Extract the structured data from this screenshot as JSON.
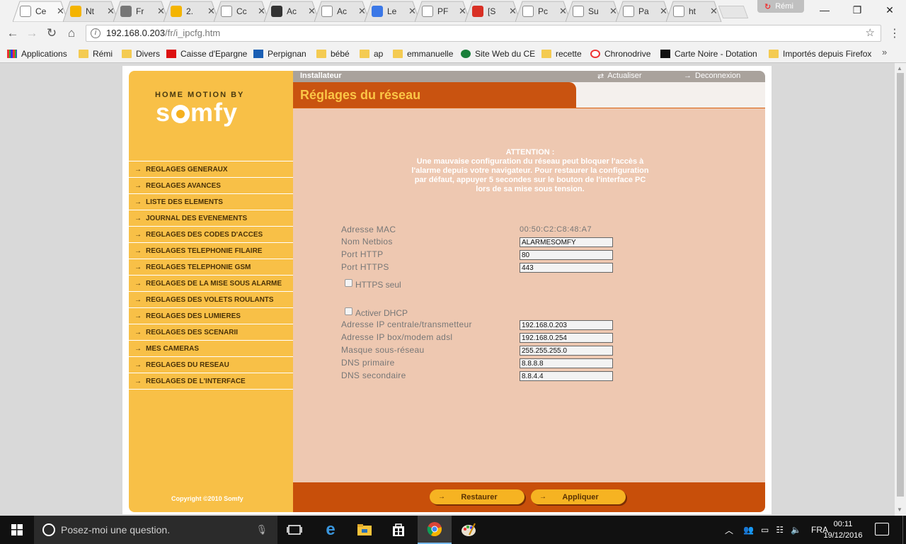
{
  "browser": {
    "tabs": [
      {
        "title": "Ce",
        "icon": "document-icon",
        "color": "#ffffff"
      },
      {
        "title": "Nt",
        "icon": "orange-circle-icon",
        "color": "#f4b400"
      },
      {
        "title": "Fr",
        "icon": "cloud-icon",
        "color": "#777777"
      },
      {
        "title": "2.",
        "icon": "clock-icon",
        "color": "#f4b400"
      },
      {
        "title": "Cc",
        "icon": "document-icon",
        "color": "#ffffff"
      },
      {
        "title": "Ac",
        "icon": "letter-a-icon",
        "color": "#333333"
      },
      {
        "title": "Ac",
        "icon": "document-icon",
        "color": "#ffffff"
      },
      {
        "title": "Le",
        "icon": "letter-e-icon",
        "color": "#3b78e7"
      },
      {
        "title": "PF",
        "icon": "document-icon",
        "color": "#ffffff"
      },
      {
        "title": "[S",
        "icon": "gmail-icon",
        "color": "#d93025"
      },
      {
        "title": "Pc",
        "icon": "document-icon",
        "color": "#ffffff"
      },
      {
        "title": "Su",
        "icon": "document-icon",
        "color": "#ffffff"
      },
      {
        "title": "Pa",
        "icon": "document-icon",
        "color": "#ffffff"
      },
      {
        "title": "ht",
        "icon": "document-icon",
        "color": "#ffffff"
      }
    ],
    "profile_name": "Rémi",
    "url_host": "192.168.0.203",
    "url_path": "/fr/i_ipcfg.htm",
    "bookmarks": [
      {
        "label": "Applications",
        "icon": "apps-grid-icon"
      },
      {
        "label": "Rémi",
        "icon": "folder-icon"
      },
      {
        "label": "Divers",
        "icon": "folder-icon"
      },
      {
        "label": "Caisse d'Epargne",
        "icon": "caisse-epargne-icon"
      },
      {
        "label": "Perpignan",
        "icon": "perpignan-icon"
      },
      {
        "label": "bébé",
        "icon": "folder-icon"
      },
      {
        "label": "ap",
        "icon": "folder-icon"
      },
      {
        "label": "emmanuelle",
        "icon": "folder-icon"
      },
      {
        "label": "Site Web du CE",
        "icon": "globe-icon"
      },
      {
        "label": "recette",
        "icon": "folder-icon"
      },
      {
        "label": "Chronodrive",
        "icon": "chronodrive-icon"
      },
      {
        "label": "Carte Noire - Dotation",
        "icon": "carte-noire-icon"
      },
      {
        "label": "Importés depuis Firefox",
        "icon": "folder-icon"
      }
    ],
    "bookmarks_more": "»"
  },
  "app": {
    "brand_top": "HOME MOTION BY",
    "brand": "somfy",
    "menu": [
      "REGLAGES GENERAUX",
      "REGLAGES AVANCES",
      "LISTE DES ELEMENTS",
      "JOURNAL DES EVENEMENTS",
      "REGLAGES DES CODES D'ACCES",
      "REGLAGES TELEPHONIE FILAIRE",
      "REGLAGES TELEPHONIE GSM",
      "REGLAGES DE LA MISE SOUS ALARME",
      "REGLAGES DES VOLETS ROULANTS",
      "REGLAGES DES LUMIERES",
      "REGLAGES DES SCENARII",
      "MES CAMERAS",
      "REGLAGES DU RESEAU",
      "REGLAGES DE L'INTERFACE"
    ],
    "copyright": "Copyright ©2010 Somfy",
    "role": "Installateur",
    "refresh_label": "Actualiser",
    "logout_label": "Deconnexion",
    "page_title": "Réglages du réseau",
    "warning_title": "ATTENTION :",
    "warning_text": "Une mauvaise configuration du réseau peut bloquer l'accès à l'alarme depuis votre navigateur. Pour restaurer la configuration par défaut, appuyer 5 secondes sur le bouton de l'interface PC lors de sa mise sous tension.",
    "mac_label": "Adresse MAC",
    "mac_value": "00:50:C2:C8:48:A7",
    "netbios_label": "Nom Netbios",
    "netbios_value": "ALARMESOMFY",
    "http_label": "Port HTTP",
    "http_value": "80",
    "https_label": "Port HTTPS",
    "https_value": "443",
    "https_only_label": "HTTPS seul",
    "https_only_checked": false,
    "dhcp_label": "Activer DHCP",
    "dhcp_checked": false,
    "ip_label": "Adresse IP centrale/transmetteur",
    "ip_value": "192.168.0.203",
    "gateway_label": "Adresse IP box/modem adsl",
    "gateway_value": "192.168.0.254",
    "mask_label": "Masque sous-réseau",
    "mask_value": "255.255.255.0",
    "dns1_label": "DNS primaire",
    "dns1_value": "8.8.8.8",
    "dns2_label": "DNS secondaire",
    "dns2_value": "8.8.4.4",
    "restore_label": "Restaurer",
    "apply_label": "Appliquer",
    "colors": {
      "sidebar": "#f8c047",
      "title_tab": "#c95310",
      "content": "#eec8b1",
      "button": "#f6b322"
    }
  },
  "taskbar": {
    "search_placeholder": "Posez-moi une question.",
    "language": "FRA",
    "time": "00:11",
    "date": "19/12/2016"
  }
}
